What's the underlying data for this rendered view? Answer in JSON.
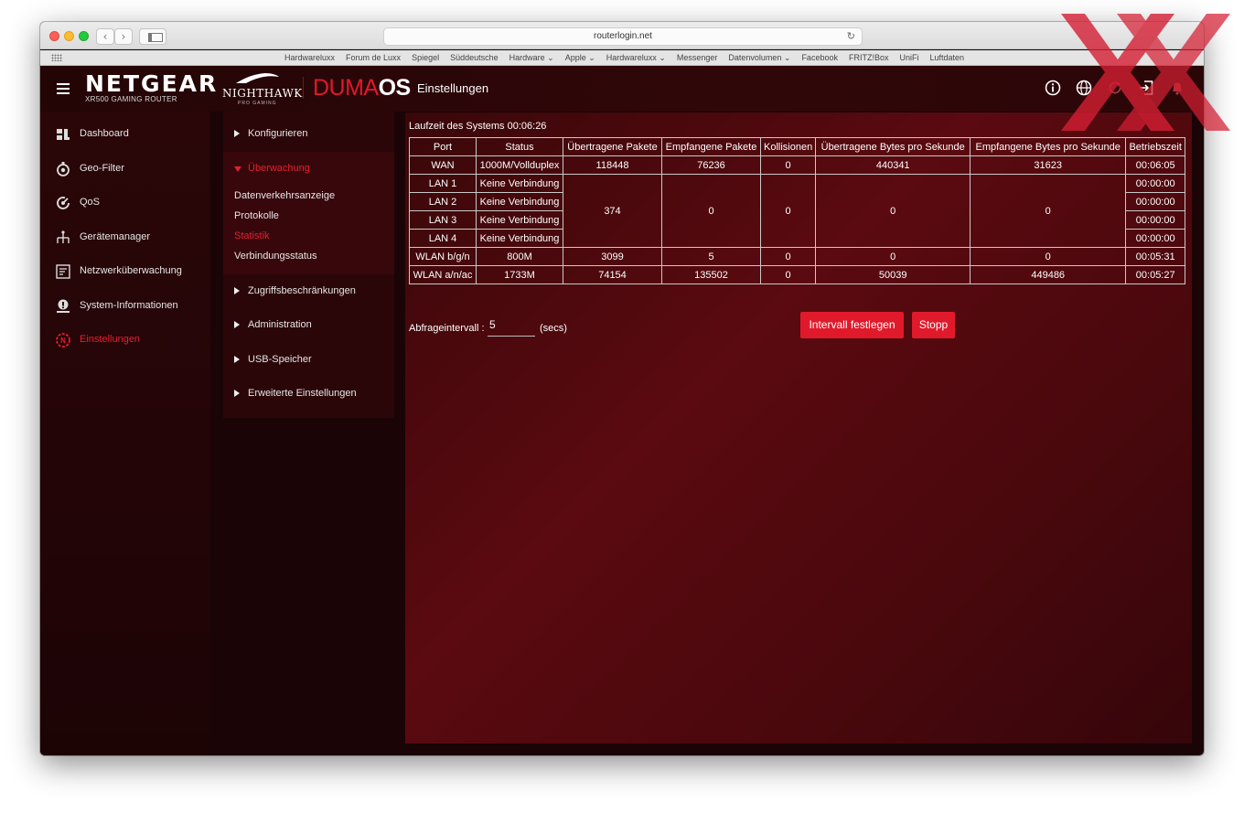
{
  "browser": {
    "url": "routerlogin.net",
    "back": "‹",
    "forward": "›",
    "bookmarks": [
      "Hardwareluxx",
      "Forum de Luxx",
      "Spiegel",
      "Süddeutsche",
      "Hardware ⌄",
      "Apple ⌄",
      "Hardwareluxx ⌄",
      "Messenger",
      "Datenvolumen ⌄",
      "Facebook",
      "FRITZ!Box",
      "UniFi",
      "Luftdaten"
    ]
  },
  "header": {
    "brand": "NETGEAR",
    "brand_sub": "XR500 GAMING ROUTER",
    "nighthawk": "NIGHTHAWK",
    "nighthawk_sub": "PRO GAMING",
    "duma_1": "DUMA",
    "duma_2": "OS",
    "title": "Einstellungen",
    "icons": [
      "info-icon",
      "globe-icon",
      "refresh-icon",
      "logout-icon",
      "bell-icon"
    ]
  },
  "nav": {
    "items": [
      {
        "label": "Dashboard",
        "icon": "dashboard-icon"
      },
      {
        "label": "Geo-Filter",
        "icon": "geo-filter-icon"
      },
      {
        "label": "QoS",
        "icon": "qos-icon"
      },
      {
        "label": "Gerätemanager",
        "icon": "device-manager-icon"
      },
      {
        "label": "Netzwerküberwachung",
        "icon": "network-monitor-icon"
      },
      {
        "label": "System-Informationen",
        "icon": "system-info-icon"
      },
      {
        "label": "Einstellungen",
        "icon": "settings-icon",
        "active": true
      }
    ]
  },
  "subnav": {
    "configure": "Konfigurieren",
    "monitoring": "Überwachung",
    "links": [
      "Datenverkehrsanzeige",
      "Protokolle",
      "Statistik",
      "Verbindungsstatus"
    ],
    "access": "Zugriffsbeschränkungen",
    "admin": "Administration",
    "usb": "USB-Speicher",
    "advanced": "Erweiterte Einstellungen"
  },
  "stats": {
    "uptime": "Laufzeit des Systems 00:06:26",
    "columns": [
      "Port",
      "Status",
      "Übertragene Pakete",
      "Empfangene Pakete",
      "Kollisionen",
      "Übertragene Bytes pro Sekunde",
      "Empfangene Bytes pro Sekunde",
      "Betriebszeit"
    ],
    "wan": {
      "port": "WAN",
      "status": "1000M/Vollduplex",
      "tx": "118448",
      "rx": "76236",
      "coll": "0",
      "txb": "440341",
      "rxb": "31623",
      "uptime": "00:06:05"
    },
    "lan": [
      {
        "port": "LAN 1",
        "status": "Keine Verbindung",
        "uptime": "00:00:00"
      },
      {
        "port": "LAN 2",
        "status": "Keine Verbindung",
        "uptime": "00:00:00"
      },
      {
        "port": "LAN 3",
        "status": "Keine Verbindung",
        "uptime": "00:00:00"
      },
      {
        "port": "LAN 4",
        "status": "Keine Verbindung",
        "uptime": "00:00:00"
      }
    ],
    "lan_shared": {
      "tx": "374",
      "rx": "0",
      "coll": "0",
      "txb": "0",
      "rxb": "0"
    },
    "wlan_bgn": {
      "port": "WLAN b/g/n",
      "status": "800M",
      "tx": "3099",
      "rx": "5",
      "coll": "0",
      "txb": "0",
      "rxb": "0",
      "uptime": "00:05:31"
    },
    "wlan_ac": {
      "port": "WLAN a/n/ac",
      "status": "1733M",
      "tx": "74154",
      "rx": "135502",
      "coll": "0",
      "txb": "50039",
      "rxb": "449486",
      "uptime": "00:05:27"
    }
  },
  "poll": {
    "label": "Abfrageintervall :",
    "value": "5",
    "unit": "(secs)",
    "set_button": "Intervall festlegen",
    "stop_button": "Stopp"
  },
  "colors": {
    "accent": "#e01a2b",
    "background": "#3a0709"
  }
}
